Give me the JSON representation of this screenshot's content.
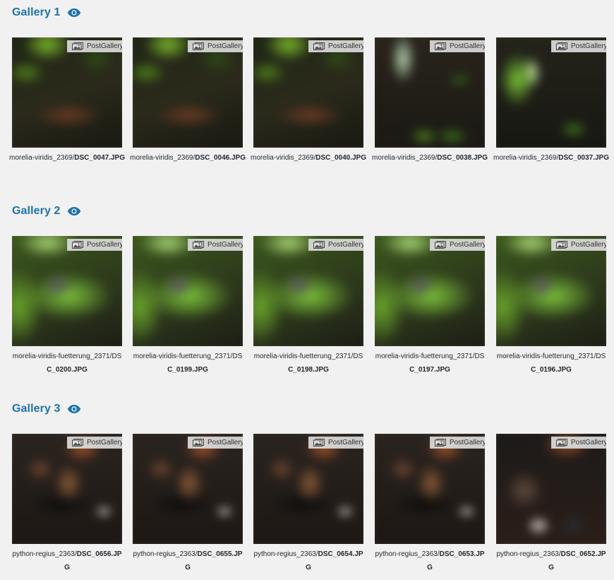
{
  "badge_label": "PostGallery",
  "galleries": [
    {
      "title": "Gallery 1",
      "items": [
        {
          "path": "morelia-viridis_2369/",
          "file": "DSC_0047.JPG",
          "look": "leafy"
        },
        {
          "path": "morelia-viridis_2369/",
          "file": "DSC_0046.JPG",
          "look": "leafy"
        },
        {
          "path": "morelia-viridis_2369/",
          "file": "DSC_0040.JPG",
          "look": "leafy"
        },
        {
          "path": "morelia-viridis_2369/",
          "file": "DSC_0038.JPG",
          "look": "coil"
        },
        {
          "path": "morelia-viridis_2369/",
          "file": "DSC_0037.JPG",
          "look": "coil2"
        }
      ]
    },
    {
      "title": "Gallery 2",
      "items": [
        {
          "path": "morelia-viridis-fuetterung_2371/DS",
          "file": "C_0200.JPG",
          "look": "green"
        },
        {
          "path": "morelia-viridis-fuetterung_2371/DS",
          "file": "C_0199.JPG",
          "look": "green"
        },
        {
          "path": "morelia-viridis-fuetterung_2371/DS",
          "file": "C_0198.JPG",
          "look": "green"
        },
        {
          "path": "morelia-viridis-fuetterung_2371/DS",
          "file": "C_0197.JPG",
          "look": "green"
        },
        {
          "path": "morelia-viridis-fuetterung_2371/DS",
          "file": "C_0196.JPG",
          "look": "green"
        }
      ]
    },
    {
      "title": "Gallery 3",
      "items": [
        {
          "path": "python-regius_2363/",
          "file": "DSC_0656.JP",
          "file2": "G",
          "look": "python"
        },
        {
          "path": "python-regius_2363/",
          "file": "DSC_0655.JP",
          "file2": "G",
          "look": "python"
        },
        {
          "path": "python-regius_2363/",
          "file": "DSC_0654.JP",
          "file2": "G",
          "look": "python"
        },
        {
          "path": "python-regius_2363/",
          "file": "DSC_0653.JP",
          "file2": "G",
          "look": "python"
        },
        {
          "path": "python-regius_2363/",
          "file": "DSC_0652.JP",
          "file2": "G",
          "look": "python2"
        }
      ]
    }
  ],
  "colors": {
    "title": "#1e73a8",
    "background": "#f1f1f1"
  },
  "icons": {
    "view": "eye-icon",
    "badge": "images-icon"
  }
}
